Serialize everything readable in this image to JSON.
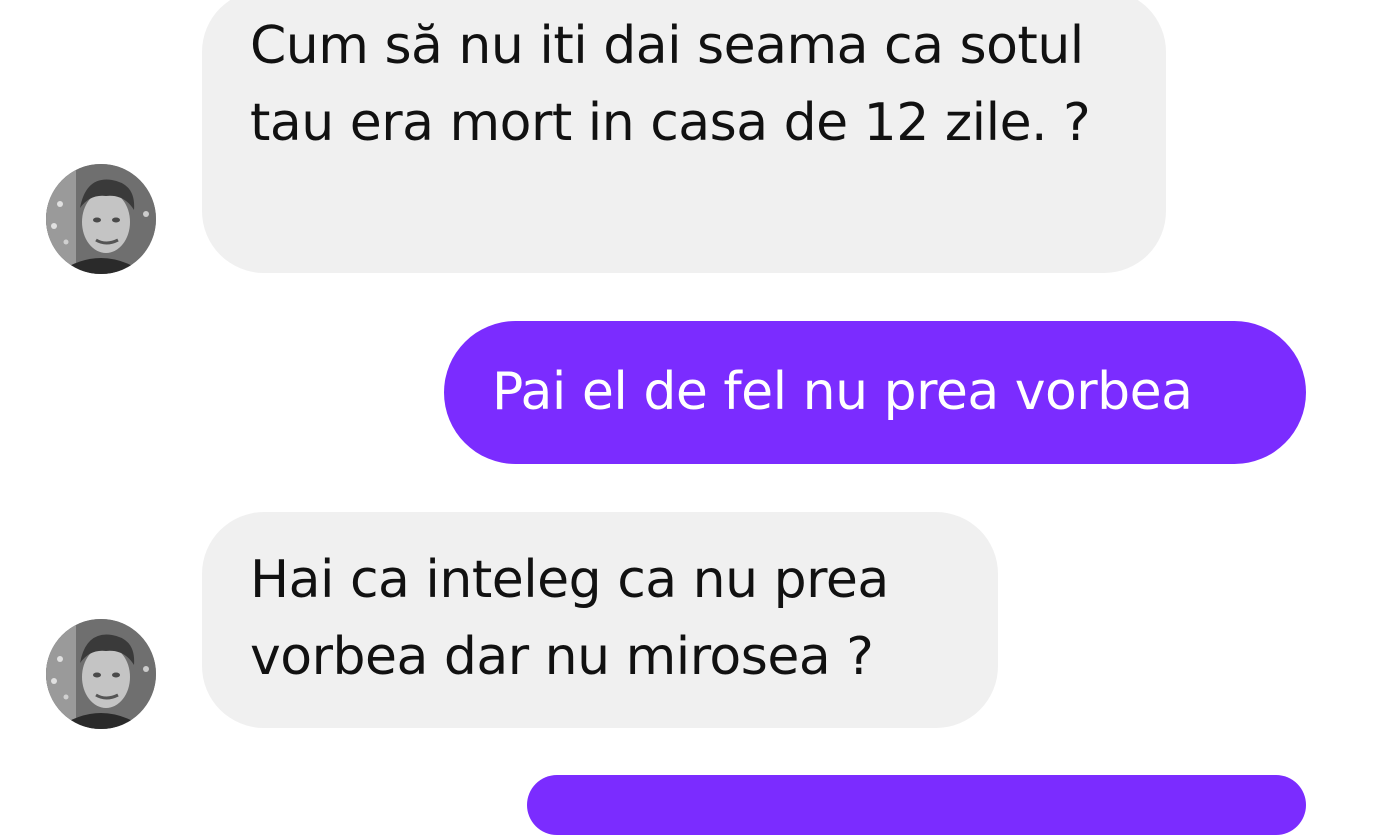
{
  "conversation": {
    "messages": [
      {
        "sender": "contact",
        "text": "Cum să nu iti dai seama ca sotul tau era mort in casa de 12 zile. ?"
      },
      {
        "sender": "me",
        "text": "Pai el de fel nu prea vorbea"
      },
      {
        "sender": "contact",
        "text": "Hai ca inteleg ca nu prea vorbea dar nu mirosea ?"
      },
      {
        "sender": "me",
        "text": ""
      }
    ]
  },
  "colors": {
    "incoming_bubble": "#f0f0f0",
    "outgoing_bubble": "#7b2cff",
    "incoming_text": "#111111",
    "outgoing_text": "#ffffff"
  },
  "icons": {
    "contact_avatar": "avatar-photo"
  }
}
